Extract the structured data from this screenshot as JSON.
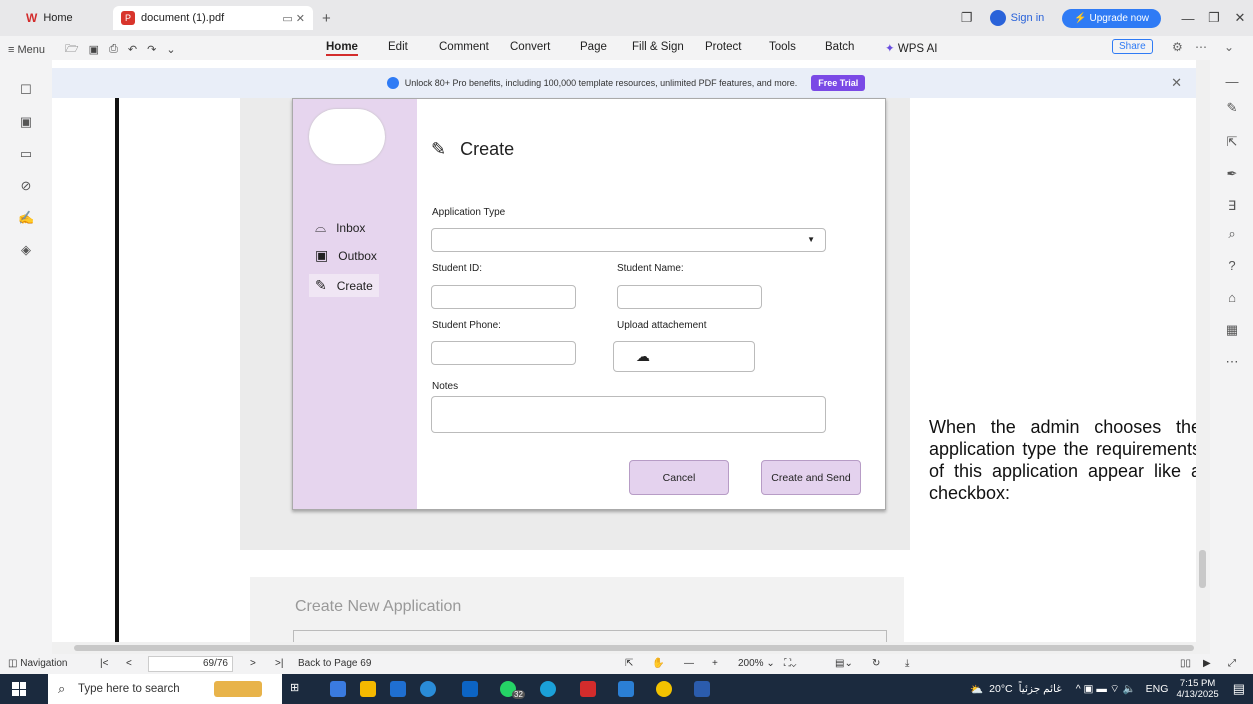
{
  "titlebar": {
    "tabs": [
      {
        "label": "Home"
      },
      {
        "label": "document (1).pdf"
      }
    ],
    "sign_in": "Sign in",
    "upgrade": "Upgrade now"
  },
  "menubar": {
    "menu_label": "Menu",
    "items": [
      "Home",
      "Edit",
      "Comment",
      "Convert",
      "Page",
      "Fill & Sign",
      "Protect",
      "Tools",
      "Batch",
      "WPS AI"
    ],
    "share": "Share"
  },
  "banner": {
    "text": "Unlock 80+ Pro benefits, including 100,000 template resources, unlimited PDF features, and more.",
    "button": "Free Trial"
  },
  "screenshot": {
    "sidebar": [
      "Inbox",
      "Outbox",
      "Create"
    ],
    "title": "Create",
    "application_type_label": "Application Type",
    "student_id_label": "Student ID:",
    "student_name_label": "Student Name:",
    "student_phone_label": "Student Phone:",
    "upload_label": "Upload attachement",
    "notes_label": "Notes",
    "cancel": "Cancel",
    "create_send": "Create and Send"
  },
  "document": {
    "description": "When the admin chooses the application type the requirements of this application appear like a checkbox:",
    "next_heading": "Create New Application"
  },
  "statusbar": {
    "navigation": "Navigation",
    "page": "69/76",
    "back_to_page": "Back to Page 69",
    "zoom": "200%"
  },
  "taskbar": {
    "search_placeholder": "Type here to search",
    "weather": "20°C",
    "weather_text": "غائم جزئياً",
    "lang": "ENG",
    "time": "7:15 PM",
    "date": "4/13/2025",
    "badge": "32"
  }
}
